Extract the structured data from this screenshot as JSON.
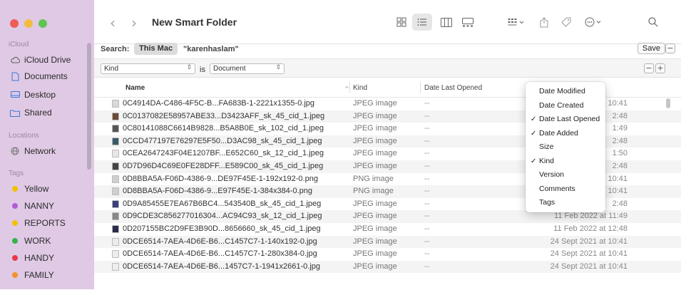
{
  "window": {
    "title": "New Smart Folder"
  },
  "sidebar": {
    "sections": [
      {
        "label": "iCloud",
        "items": [
          {
            "label": "iCloud Drive",
            "icon": "cloud-icon"
          },
          {
            "label": "Documents",
            "icon": "document-icon"
          },
          {
            "label": "Desktop",
            "icon": "desktop-icon"
          },
          {
            "label": "Shared",
            "icon": "shared-folder-icon"
          }
        ]
      },
      {
        "label": "Locations",
        "items": [
          {
            "label": "Network",
            "icon": "network-icon"
          }
        ]
      },
      {
        "label": "Tags",
        "items": [
          {
            "label": "Yellow",
            "color": "#f2c200"
          },
          {
            "label": "NANNY",
            "color": "#b35ad6"
          },
          {
            "label": "REPORTS",
            "color": "#f2c200"
          },
          {
            "label": "WORK",
            "color": "#34b34a"
          },
          {
            "label": "HANDY",
            "color": "#e8384a"
          },
          {
            "label": "FAMILY",
            "color": "#f4922b"
          }
        ]
      }
    ]
  },
  "search": {
    "label": "Search:",
    "scope_selected": "This Mac",
    "scope_other": "\"karenhaslam\"",
    "save_label": "Save",
    "minus": "−",
    "plus": "+"
  },
  "criteria": {
    "attribute": "Kind",
    "operator": "is",
    "value": "Document"
  },
  "columns": {
    "name": "Name",
    "kind": "Kind",
    "last_opened": "Date Last Opened"
  },
  "files": [
    {
      "name": "0C4914DA-C486-4F5C-B...FA683B-1-2221x1355-0.jpg",
      "kind": "JPEG image",
      "opened": "--",
      "date": "10:41",
      "icon_color": "#d8d8d8"
    },
    {
      "name": "0C0137082E58957ABE33...D3423AFF_sk_45_cid_1.jpeg",
      "kind": "JPEG image",
      "opened": "--",
      "date": "2:48",
      "icon_color": "#6b4a3a"
    },
    {
      "name": "0C80141088C6614B9828...B5A8B0E_sk_102_cid_1.jpeg",
      "kind": "JPEG image",
      "opened": "--",
      "date": "1:49",
      "icon_color": "#555555"
    },
    {
      "name": "0CCD477197E76297E5F50...D3AC98_sk_45_cid_1.jpeg",
      "kind": "JPEG image",
      "opened": "--",
      "date": "2:48",
      "icon_color": "#3a5a6a"
    },
    {
      "name": "0CEA2647243F04E1207BF...E652C60_sk_12_cid_1.jpeg",
      "kind": "JPEG image",
      "opened": "--",
      "date": "1:50",
      "icon_color": "#e6e6e6"
    },
    {
      "name": "0D7D96D4C69E0FE28DFF...E589C00_sk_45_cid_1.jpeg",
      "kind": "JPEG image",
      "opened": "--",
      "date": "2:48",
      "icon_color": "#444444"
    },
    {
      "name": "0D8BBA5A-F06D-4386-9...DE97F45E-1-192x192-0.png",
      "kind": "PNG image",
      "opened": "--",
      "date": "10:41",
      "icon_color": "#cfcfcf"
    },
    {
      "name": "0D8BBA5A-F06D-4386-9...E97F45E-1-384x384-0.png",
      "kind": "PNG image",
      "opened": "--",
      "date": "10:41",
      "icon_color": "#cfcfcf"
    },
    {
      "name": "0D9A85455E7EA67B6BC4...543540B_sk_45_cid_1.jpeg",
      "kind": "JPEG image",
      "opened": "--",
      "date": "2:48",
      "icon_color": "#3b3f7a"
    },
    {
      "name": "0D9CDE3C856277016304...AC94C93_sk_12_cid_1.jpeg",
      "kind": "JPEG image",
      "opened": "--",
      "date": "11 Feb 2022 at 11:49",
      "icon_color": "#888888"
    },
    {
      "name": "0D207155BC2D9FE3B90D...8656660_sk_45_cid_1.jpeg",
      "kind": "JPEG image",
      "opened": "--",
      "date": "11 Feb 2022 at 12:48",
      "icon_color": "#2a2a4a"
    },
    {
      "name": "0DCE6514-7AEA-4D6E-B6...C1457C7-1-140x192-0.jpg",
      "kind": "JPEG image",
      "opened": "--",
      "date": "24 Sept 2021 at 10:41",
      "icon_color": "#ededed"
    },
    {
      "name": "0DCE6514-7AEA-4D6E-B6...C1457C7-1-280x384-0.jpg",
      "kind": "JPEG image",
      "opened": "--",
      "date": "24 Sept 2021 at 10:41",
      "icon_color": "#ededed"
    },
    {
      "name": "0DCE6514-7AEA-4D6E-B6...1457C7-1-1941x2661-0.jpg",
      "kind": "JPEG image",
      "opened": "--",
      "date": "24 Sept 2021 at 10:41",
      "icon_color": "#ededed"
    }
  ],
  "column_menu": [
    {
      "label": "Date Modified",
      "checked": false
    },
    {
      "label": "Date Created",
      "checked": false
    },
    {
      "label": "Date Last Opened",
      "checked": true
    },
    {
      "label": "Date Added",
      "checked": true
    },
    {
      "label": "Size",
      "checked": false
    },
    {
      "label": "Kind",
      "checked": true
    },
    {
      "label": "Version",
      "checked": false
    },
    {
      "label": "Comments",
      "checked": false
    },
    {
      "label": "Tags",
      "checked": false
    }
  ],
  "checkmark": "✓"
}
